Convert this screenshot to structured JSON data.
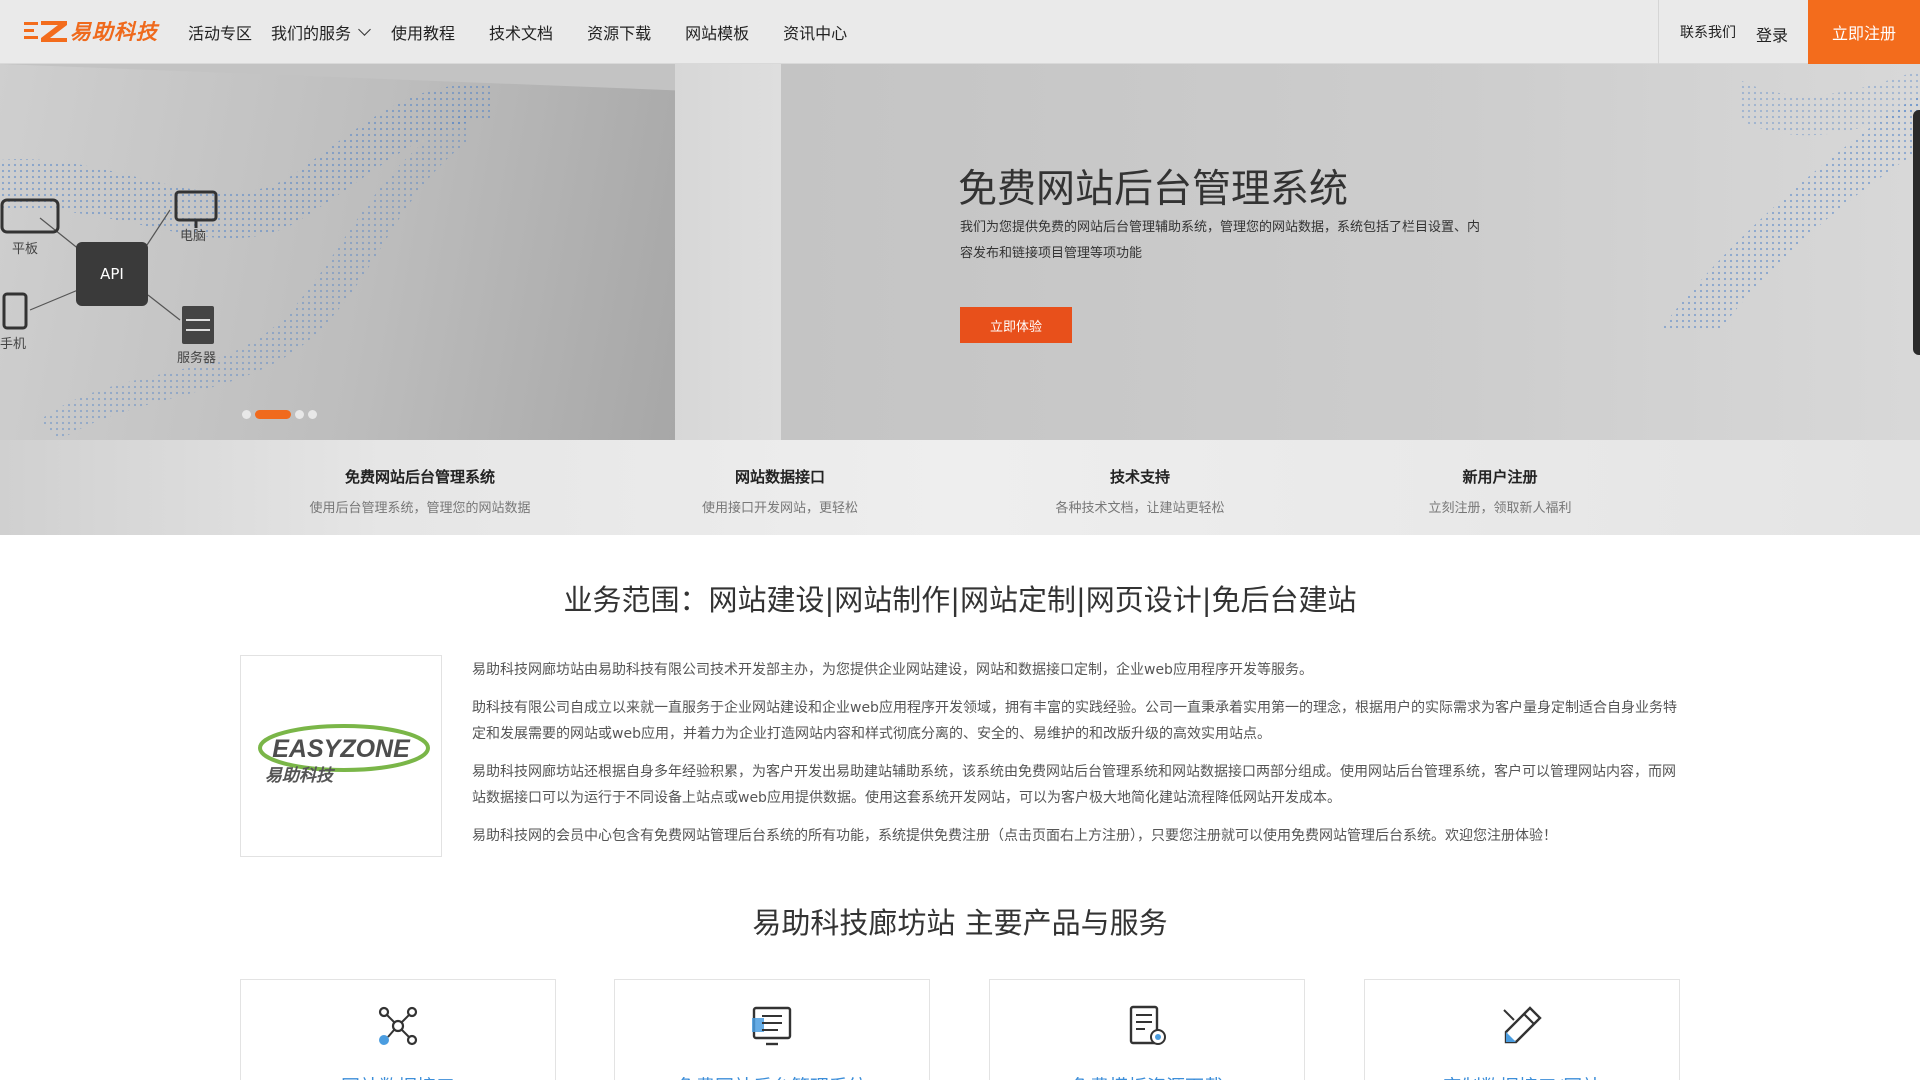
{
  "brand": {
    "name": "易助科技",
    "accent": "#f36c1c"
  },
  "nav": {
    "items": [
      {
        "label": "活动专区"
      },
      {
        "label": "我们的服务",
        "dropdown": true
      },
      {
        "label": "使用教程"
      },
      {
        "label": "技术文档"
      },
      {
        "label": "资源下载"
      },
      {
        "label": "网站模板"
      },
      {
        "label": "资讯中心"
      }
    ],
    "contact": "联系我们",
    "login": "登录",
    "register": "立即注册"
  },
  "hero": {
    "title": "免费网站后台管理系统",
    "description": "我们为您提供免费的网站后台管理辅助系统，管理您的网站数据，系统包括了栏目设置、内容发布和链接项目管理等项功能",
    "cta": "立即体验",
    "diagram": {
      "chip": "API",
      "labels": [
        "平板",
        "电脑",
        "手机",
        "服务器"
      ]
    },
    "carousel": {
      "slides": 4,
      "active": 2
    }
  },
  "features": [
    {
      "title": "免费网站后台管理系统",
      "desc": "使用后台管理系统，管理您的网站数据"
    },
    {
      "title": "网站数据接口",
      "desc": "使用接口开发网站，更轻松"
    },
    {
      "title": "技术支持",
      "desc": "各种技术文档，让建站更轻松"
    },
    {
      "title": "新用户注册",
      "desc": "立刻注册，领取新人福利"
    }
  ],
  "business": {
    "title": "业务范围：网站建设|网站制作|网站定制|网页设计|免后台建站",
    "logo_text": "EASYZONE",
    "logo_sub": "易助科技",
    "paragraphs": [
      "易助科技网廊坊站由易助科技有限公司技术开发部主办，为您提供企业网站建设，网站和数据接口定制，企业web应用程序开发等服务。",
      "助科技有限公司自成立以来就一直服务于企业网站建设和企业web应用程序开发领域，拥有丰富的实践经验。公司一直秉承着实用第一的理念，根据用户的实际需求为客户量身定制适合自身业务特定和发展需要的网站或web应用，并着力为企业打造网站内容和样式彻底分离的、安全的、易维护的和改版升级的高效实用站点。",
      "易助科技网廊坊站还根据自身多年经验积累，为客户开发出易助建站辅助系统，该系统由免费网站后台管理系统和网站数据接口两部分组成。使用网站后台管理系统，客户可以管理网站内容，而网站数据接口可以为运行于不同设备上站点或web应用提供数据。使用这套系统开发网站，可以为客户极大地简化建站流程降低网站开发成本。",
      "易助科技网的会员中心包含有免费网站管理后台系统的所有功能，系统提供免费注册（点击页面右上方注册），只要您注册就可以使用免费网站管理后台系统。欢迎您注册体验！"
    ]
  },
  "products": {
    "title": "易助科技廊坊站 主要产品与服务",
    "items": [
      {
        "name": "网站数据接口",
        "icon": "network-nodes-icon"
      },
      {
        "name": "免费网站后台管理系统",
        "icon": "admin-panel-icon"
      },
      {
        "name": "免费模板资源下载",
        "icon": "template-settings-icon"
      },
      {
        "name": "定制数据接口/网站",
        "icon": "edit-pen-icon"
      }
    ]
  }
}
